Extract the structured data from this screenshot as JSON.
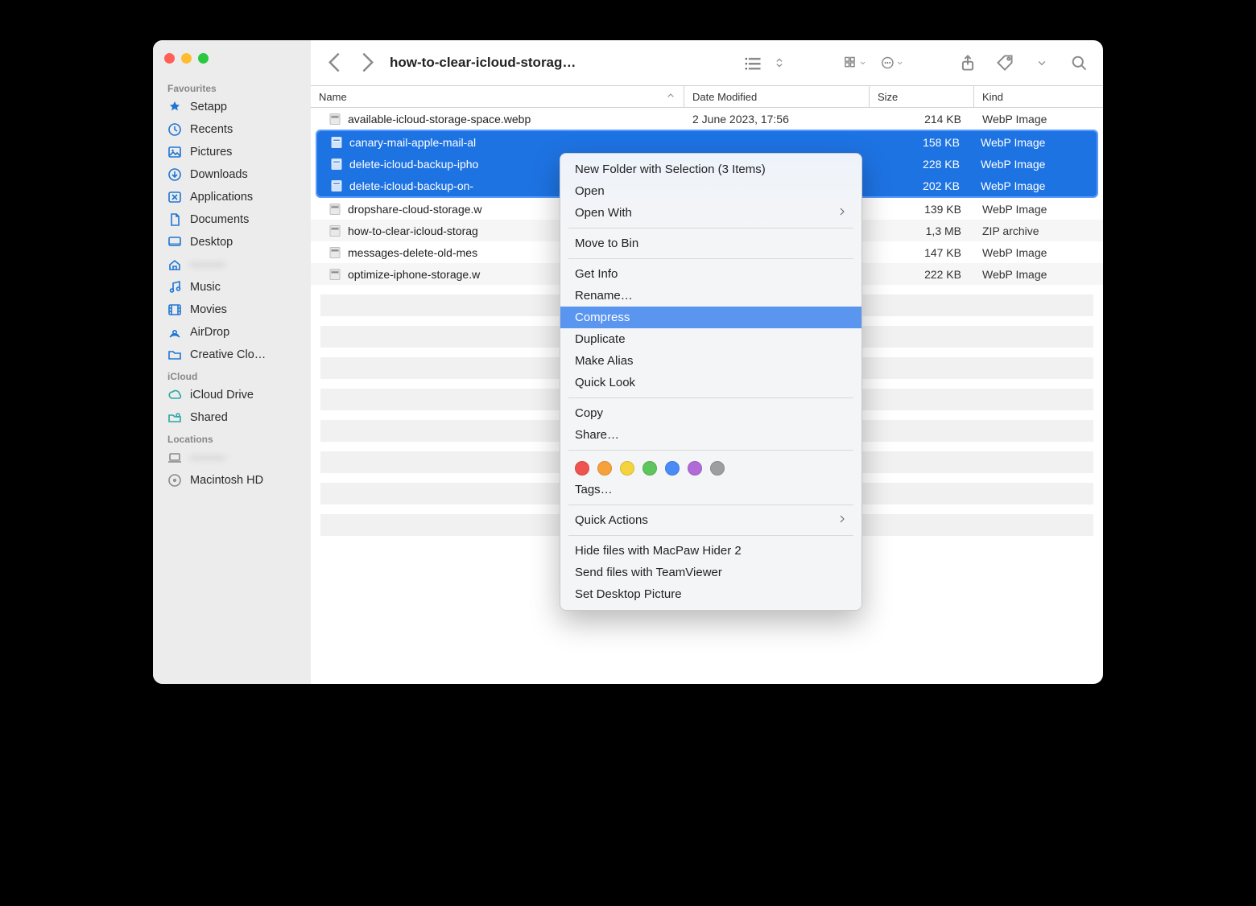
{
  "window": {
    "title": "how-to-clear-icloud-storag…"
  },
  "sidebar": {
    "sections": [
      {
        "label": "Favourites",
        "items": [
          {
            "label": "Setapp",
            "icon": "setapp-icon",
            "color": "#1e76d4"
          },
          {
            "label": "Recents",
            "icon": "clock-icon",
            "color": "#1e76d4"
          },
          {
            "label": "Pictures",
            "icon": "pictures-icon",
            "color": "#1e76d4"
          },
          {
            "label": "Downloads",
            "icon": "download-icon",
            "color": "#1e76d4"
          },
          {
            "label": "Applications",
            "icon": "applications-icon",
            "color": "#1e76d4"
          },
          {
            "label": "Documents",
            "icon": "documents-icon",
            "color": "#1e76d4"
          },
          {
            "label": "Desktop",
            "icon": "desktop-icon",
            "color": "#1e76d4"
          },
          {
            "label": "———",
            "icon": "home-icon",
            "color": "#1e76d4",
            "blurred": true
          },
          {
            "label": "Music",
            "icon": "music-icon",
            "color": "#1e76d4"
          },
          {
            "label": "Movies",
            "icon": "movies-icon",
            "color": "#1e76d4"
          },
          {
            "label": "AirDrop",
            "icon": "airdrop-icon",
            "color": "#1e76d4"
          },
          {
            "label": "Creative Clo…",
            "icon": "folder-icon",
            "color": "#1e76d4"
          }
        ]
      },
      {
        "label": "iCloud",
        "items": [
          {
            "label": "iCloud Drive",
            "icon": "cloud-icon",
            "color": "#2aa7a0"
          },
          {
            "label": "Shared",
            "icon": "shared-icon",
            "color": "#2aa7a0"
          }
        ]
      },
      {
        "label": "Locations",
        "items": [
          {
            "label": "———",
            "icon": "laptop-icon",
            "color": "#8a8a8a",
            "blurred": true
          },
          {
            "label": "Macintosh HD",
            "icon": "disk-icon",
            "color": "#8a8a8a"
          }
        ]
      }
    ]
  },
  "columns": {
    "name": "Name",
    "date": "Date Modified",
    "size": "Size",
    "kind": "Kind"
  },
  "files": [
    {
      "name": "available-icloud-storage-space.webp",
      "date": "2 June 2023, 17:56",
      "size": "214 KB",
      "kind": "WebP Image",
      "selected": false
    },
    {
      "name": "canary-mail-apple-mail-al",
      "date": "",
      "size": "158 KB",
      "kind": "WebP Image",
      "selected": true
    },
    {
      "name": "delete-icloud-backup-ipho",
      "date": "",
      "size": "228 KB",
      "kind": "WebP Image",
      "selected": true
    },
    {
      "name": "delete-icloud-backup-on-",
      "date": "",
      "size": "202 KB",
      "kind": "WebP Image",
      "selected": true
    },
    {
      "name": "dropshare-cloud-storage.w",
      "date": "",
      "size": "139 KB",
      "kind": "WebP Image",
      "selected": false
    },
    {
      "name": "how-to-clear-icloud-storag",
      "date": "",
      "size": "1,3 MB",
      "kind": "ZIP archive",
      "selected": false
    },
    {
      "name": "messages-delete-old-mes",
      "date": "",
      "size": "147 KB",
      "kind": "WebP Image",
      "selected": false
    },
    {
      "name": "optimize-iphone-storage.w",
      "date": "",
      "size": "222 KB",
      "kind": "WebP Image",
      "selected": false
    }
  ],
  "context_menu": {
    "groups": [
      [
        "New Folder with Selection (3 Items)",
        "Open",
        {
          "label": "Open With",
          "submenu": true
        }
      ],
      [
        "Move to Bin"
      ],
      [
        "Get Info",
        "Rename…",
        {
          "label": "Compress",
          "highlight": true
        },
        "Duplicate",
        "Make Alias",
        "Quick Look"
      ],
      [
        "Copy",
        "Share…"
      ],
      [
        {
          "tags": [
            "#ef5350",
            "#f7a13c",
            "#f4d33f",
            "#5ec45e",
            "#4a8bf5",
            "#b06bd8",
            "#9e9e9e"
          ]
        },
        "Tags…"
      ],
      [
        {
          "label": "Quick Actions",
          "submenu": true
        }
      ],
      [
        "Hide files with MacPaw Hider 2",
        "Send files with TeamViewer",
        "Set Desktop Picture"
      ]
    ]
  }
}
